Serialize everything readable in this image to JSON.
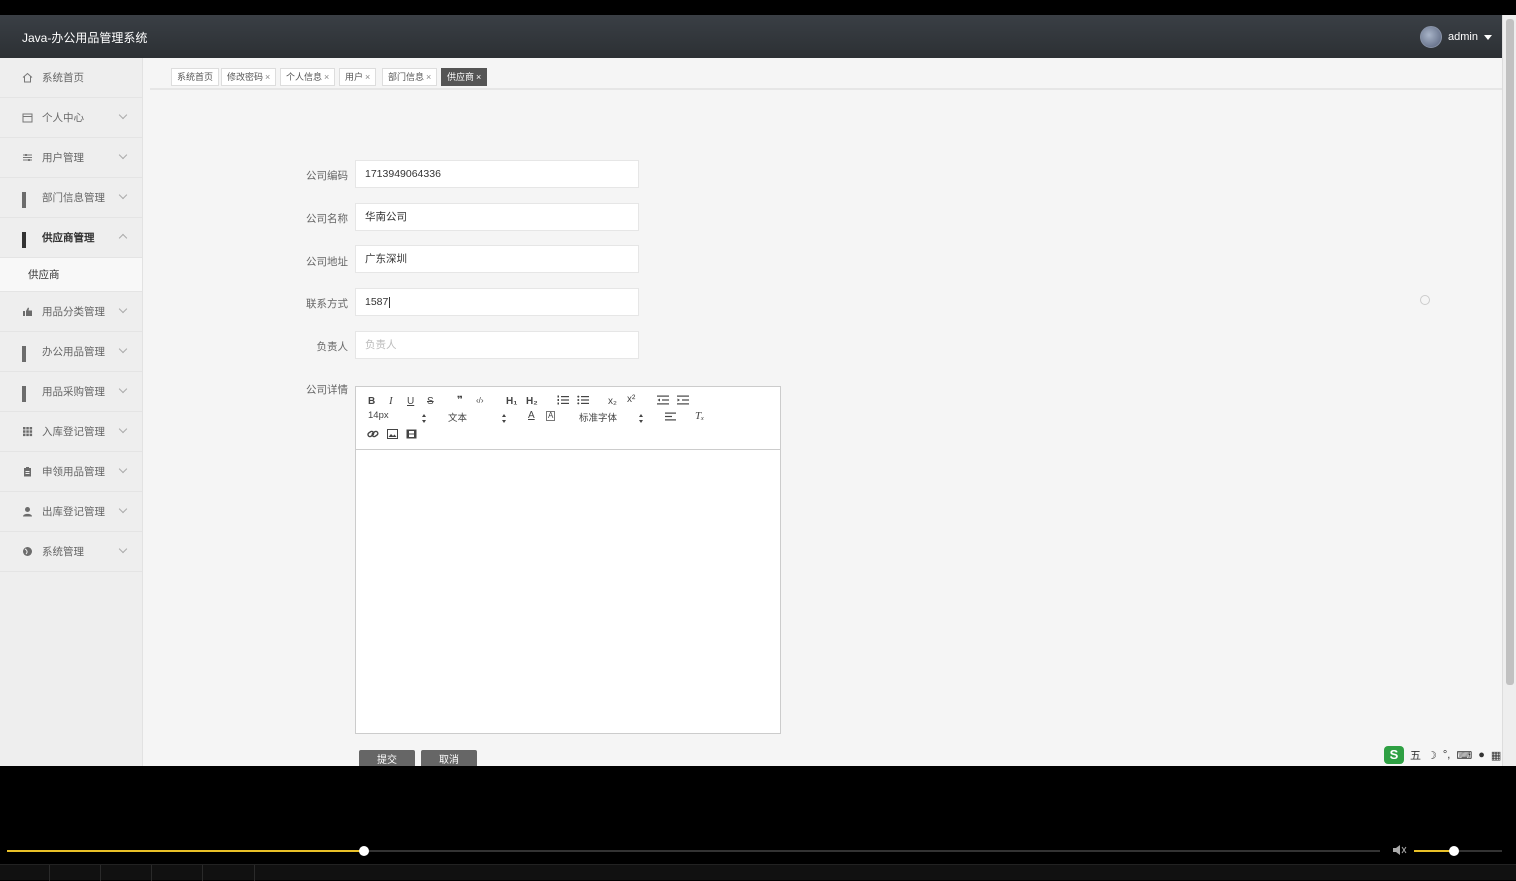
{
  "app": {
    "title": "Java-办公用品管理系统",
    "user_name": "admin"
  },
  "sidebar": {
    "items": [
      {
        "label": "系统首页",
        "icon": "home-icon"
      },
      {
        "label": "个人中心",
        "icon": "calendar-icon"
      },
      {
        "label": "用户管理",
        "icon": "sliders-icon"
      },
      {
        "label": "部门信息管理",
        "icon": "grid-icon"
      },
      {
        "label": "供应商管理",
        "icon": "grid-icon",
        "sub": [
          "供应商"
        ]
      },
      {
        "label": "用品分类管理",
        "icon": "thumbs-up-icon"
      },
      {
        "label": "办公用品管理",
        "icon": "grid-icon"
      },
      {
        "label": "用品采购管理",
        "icon": "grid-icon"
      },
      {
        "label": "入库登记管理",
        "icon": "table-icon"
      },
      {
        "label": "申领用品管理",
        "icon": "clipboard-icon"
      },
      {
        "label": "出库登记管理",
        "icon": "user-icon"
      },
      {
        "label": "系统管理",
        "icon": "globe-icon"
      }
    ]
  },
  "tabs": [
    {
      "label": "系统首页"
    },
    {
      "label": "修改密码",
      "close": "×"
    },
    {
      "label": "个人信息",
      "close": "×"
    },
    {
      "label": "用户",
      "close": "×"
    },
    {
      "label": "部门信息",
      "close": "×"
    },
    {
      "label": "供应商",
      "close": "×"
    }
  ],
  "form": {
    "fields": [
      {
        "label": "公司编码",
        "value": "1713949064336",
        "placeholder": ""
      },
      {
        "label": "公司名称",
        "value": "华南公司",
        "placeholder": ""
      },
      {
        "label": "公司地址",
        "value": "广东深圳",
        "placeholder": ""
      },
      {
        "label": "联系方式",
        "value": "1587",
        "placeholder": ""
      },
      {
        "label": "负责人",
        "value": "",
        "placeholder": "负责人"
      }
    ],
    "detail_label": "公司详情",
    "editor": {
      "font_size": "14px",
      "header": "文本",
      "font_family": "标准字体",
      "bold": "B",
      "italic": "I",
      "underline": "U",
      "strike": "S",
      "quote": "❞",
      "code": "‹/›",
      "h1": "H₁",
      "h2": "H₂",
      "sub": "x₂",
      "sup": "x²",
      "clean": "Tₓ"
    },
    "submit_label": "提交",
    "cancel_label": "取消"
  },
  "ime": {
    "mode": "五"
  },
  "player": {
    "progress_fraction": 0.26,
    "volume_fraction": 0.45,
    "accent": "#e8c028"
  }
}
